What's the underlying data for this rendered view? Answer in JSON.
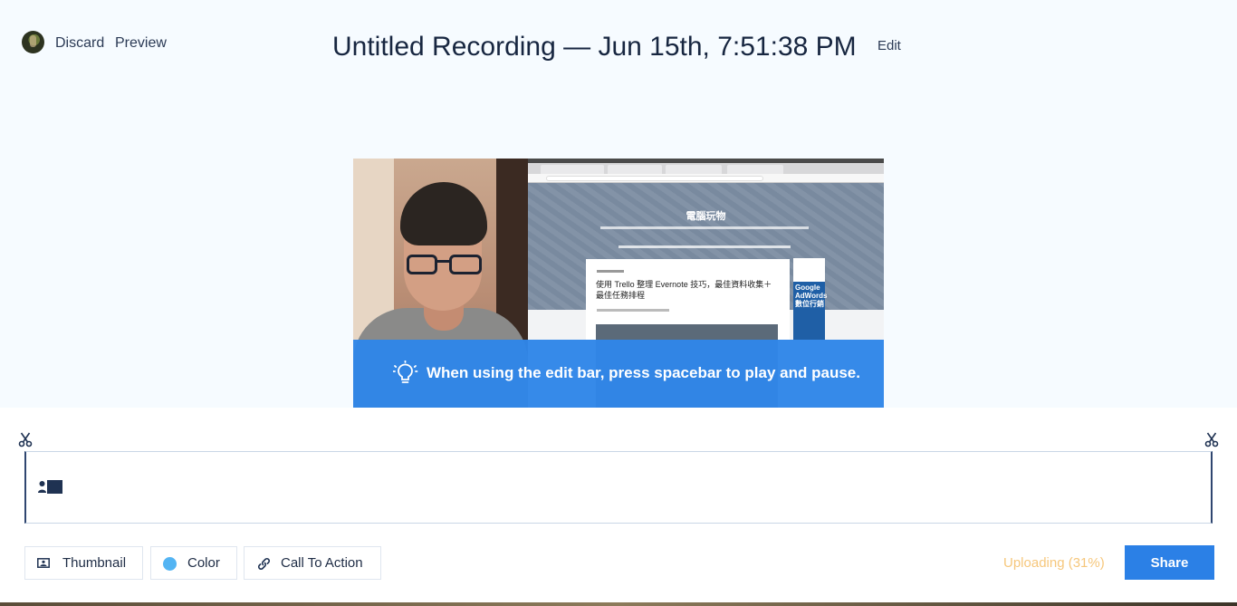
{
  "header": {
    "discard_label": "Discard",
    "preview_label": "Preview",
    "recording_title": "Untitled Recording — Jun 15th, 7:51:38 PM",
    "edit_label": "Edit"
  },
  "preview": {
    "screen_site_title": "電腦玩物",
    "screen_article_title": "使用 Trello 整理 Evernote 技巧，最佳資料收集＋最佳任務排程",
    "screen_ad_text": "Google AdWords 數位行銷"
  },
  "tip": {
    "text": "When using the edit bar, press spacebar to play and pause.",
    "icon": "lightbulb-icon"
  },
  "toolbar": {
    "thumbnail_label": "Thumbnail",
    "color_label": "Color",
    "cta_label": "Call To Action",
    "color_value": "#53b4f3"
  },
  "status": {
    "uploading_text": "Uploading (31%)",
    "upload_progress_percent": 31
  },
  "share_label": "Share",
  "colors": {
    "accent": "#2b80e6",
    "tip_banner": "#2f86e8",
    "uploading": "#f6c77c",
    "title_text": "#172640"
  }
}
